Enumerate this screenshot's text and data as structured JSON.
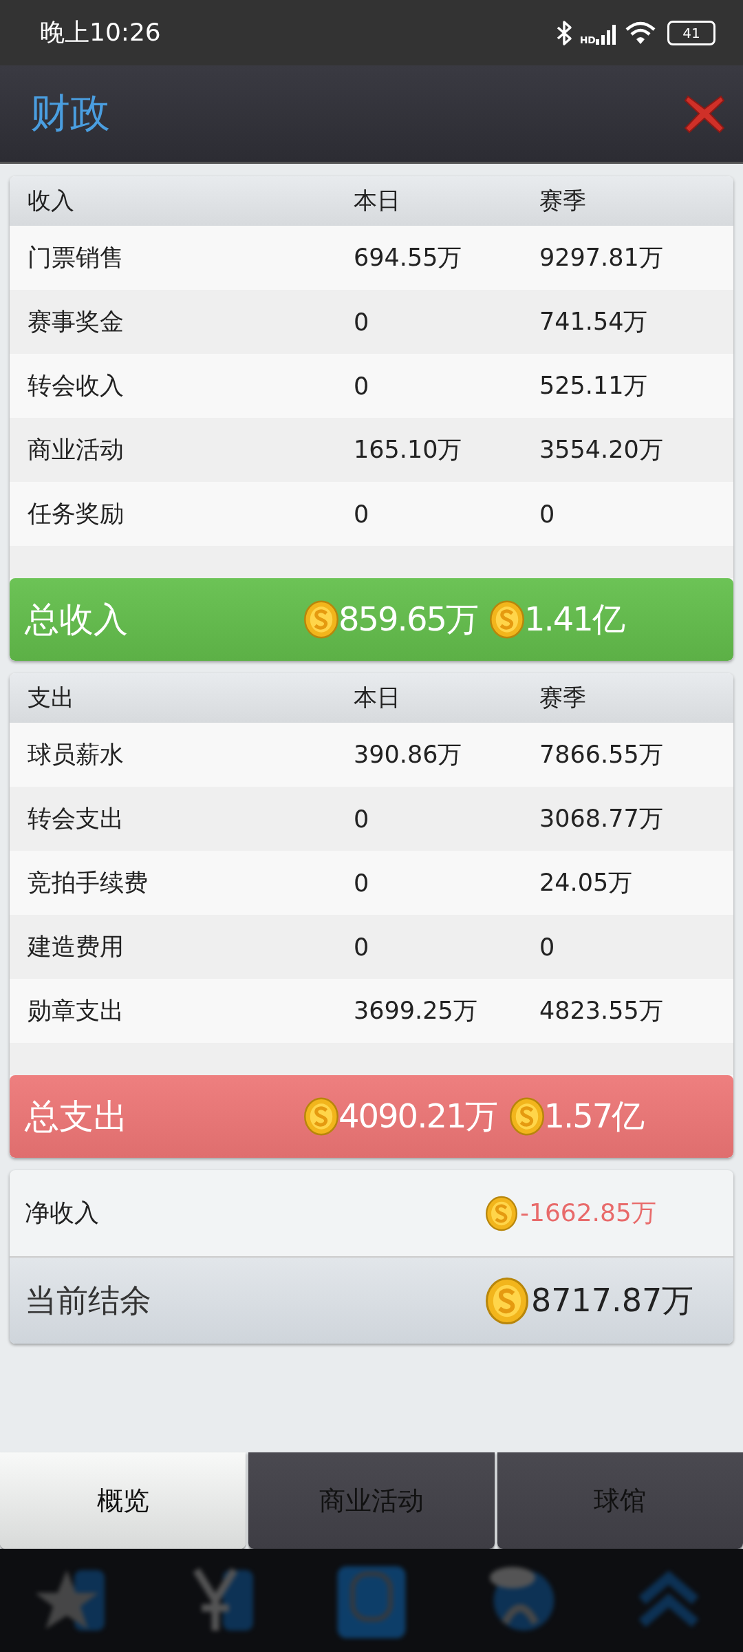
{
  "status_bar": {
    "time": "晚上10:26",
    "network": "HD",
    "battery": "41"
  },
  "header": {
    "title": "财政"
  },
  "sections": [
    {
      "kind": "income",
      "columns": [
        "收入",
        "本日",
        "赛季"
      ],
      "rows": [
        {
          "item": "门票销售",
          "day": "694.55万",
          "season": "9297.81万"
        },
        {
          "item": "赛事奖金",
          "day": "0",
          "season": "741.54万"
        },
        {
          "item": "转会收入",
          "day": "0",
          "season": "525.11万"
        },
        {
          "item": "商业活动",
          "day": "165.10万",
          "season": "3554.20万"
        },
        {
          "item": "任务奖励",
          "day": "0",
          "season": "0"
        }
      ],
      "total": {
        "label": "总收入",
        "day": "859.65万",
        "season": "1.41亿"
      }
    },
    {
      "kind": "expense",
      "columns": [
        "支出",
        "本日",
        "赛季"
      ],
      "rows": [
        {
          "item": "球员薪水",
          "day": "390.86万",
          "season": "7866.55万"
        },
        {
          "item": "转会支出",
          "day": "0",
          "season": "3068.77万"
        },
        {
          "item": "竞拍手续费",
          "day": "0",
          "season": "24.05万"
        },
        {
          "item": "建造费用",
          "day": "0",
          "season": "0"
        },
        {
          "item": "勋章支出",
          "day": "3699.25万",
          "season": "4823.55万"
        }
      ],
      "total": {
        "label": "总支出",
        "day": "4090.21万",
        "season": "1.57亿"
      }
    }
  ],
  "net": {
    "label": "净收入",
    "value": "-1662.85万"
  },
  "balance": {
    "label": "当前结余",
    "value": "8717.87万"
  },
  "tabs": [
    {
      "label": "概览",
      "selected": true
    },
    {
      "label": "商业活动",
      "selected": false
    },
    {
      "label": "球馆",
      "selected": false
    }
  ]
}
